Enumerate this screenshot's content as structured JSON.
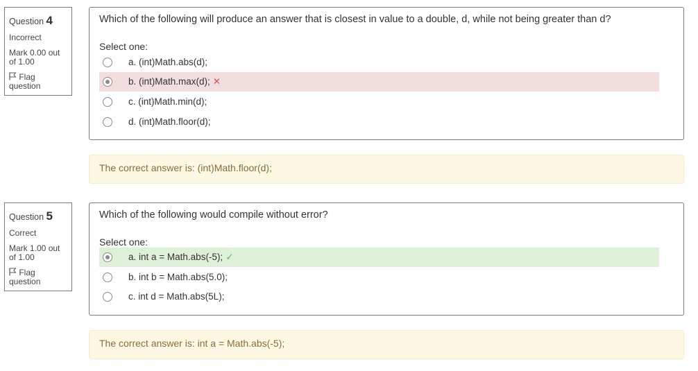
{
  "questions": [
    {
      "number_label": "Question",
      "number": "4",
      "state": "Incorrect",
      "grade": "Mark 0.00 out of 1.00",
      "flag_label": "Flag question",
      "text": "Which of the following will produce an answer that is closest in value to a double, d, while not being greater than d?",
      "prompt": "Select one:",
      "options": [
        {
          "label": "a. (int)Math.abs(d);",
          "checked": false,
          "status": "",
          "mark": ""
        },
        {
          "label": "b. (int)Math.max(d);",
          "checked": true,
          "status": "incorrect",
          "mark": "✕"
        },
        {
          "label": "c. (int)Math.min(d);",
          "checked": false,
          "status": "",
          "mark": ""
        },
        {
          "label": "d. (int)Math.floor(d);",
          "checked": false,
          "status": "",
          "mark": ""
        }
      ],
      "feedback": "The correct answer is: (int)Math.floor(d);"
    },
    {
      "number_label": "Question",
      "number": "5",
      "state": "Correct",
      "grade": "Mark 1.00 out of 1.00",
      "flag_label": "Flag question",
      "text": "Which of the following would compile without error?",
      "prompt": "Select one:",
      "options": [
        {
          "label": "a. int a = Math.abs(-5);",
          "checked": true,
          "status": "correct",
          "mark": "✓"
        },
        {
          "label": "b. int b = Math.abs(5.0);",
          "checked": false,
          "status": "",
          "mark": ""
        },
        {
          "label": "c. int d = Math.abs(5L);",
          "checked": false,
          "status": "",
          "mark": ""
        }
      ],
      "feedback": "The correct answer is: int a = Math.abs(-5);"
    }
  ],
  "colors": {
    "incorrect_bg": "#f2dede",
    "correct_bg": "#dff0d8",
    "feedback_bg": "#fcf8e3",
    "feedback_text": "#8a6d3b",
    "wrong_mark": "#d9534f",
    "right_mark": "#5cb85c"
  },
  "icons": {
    "flag": "flag-icon",
    "incorrect": "cross-icon",
    "correct": "check-icon"
  }
}
